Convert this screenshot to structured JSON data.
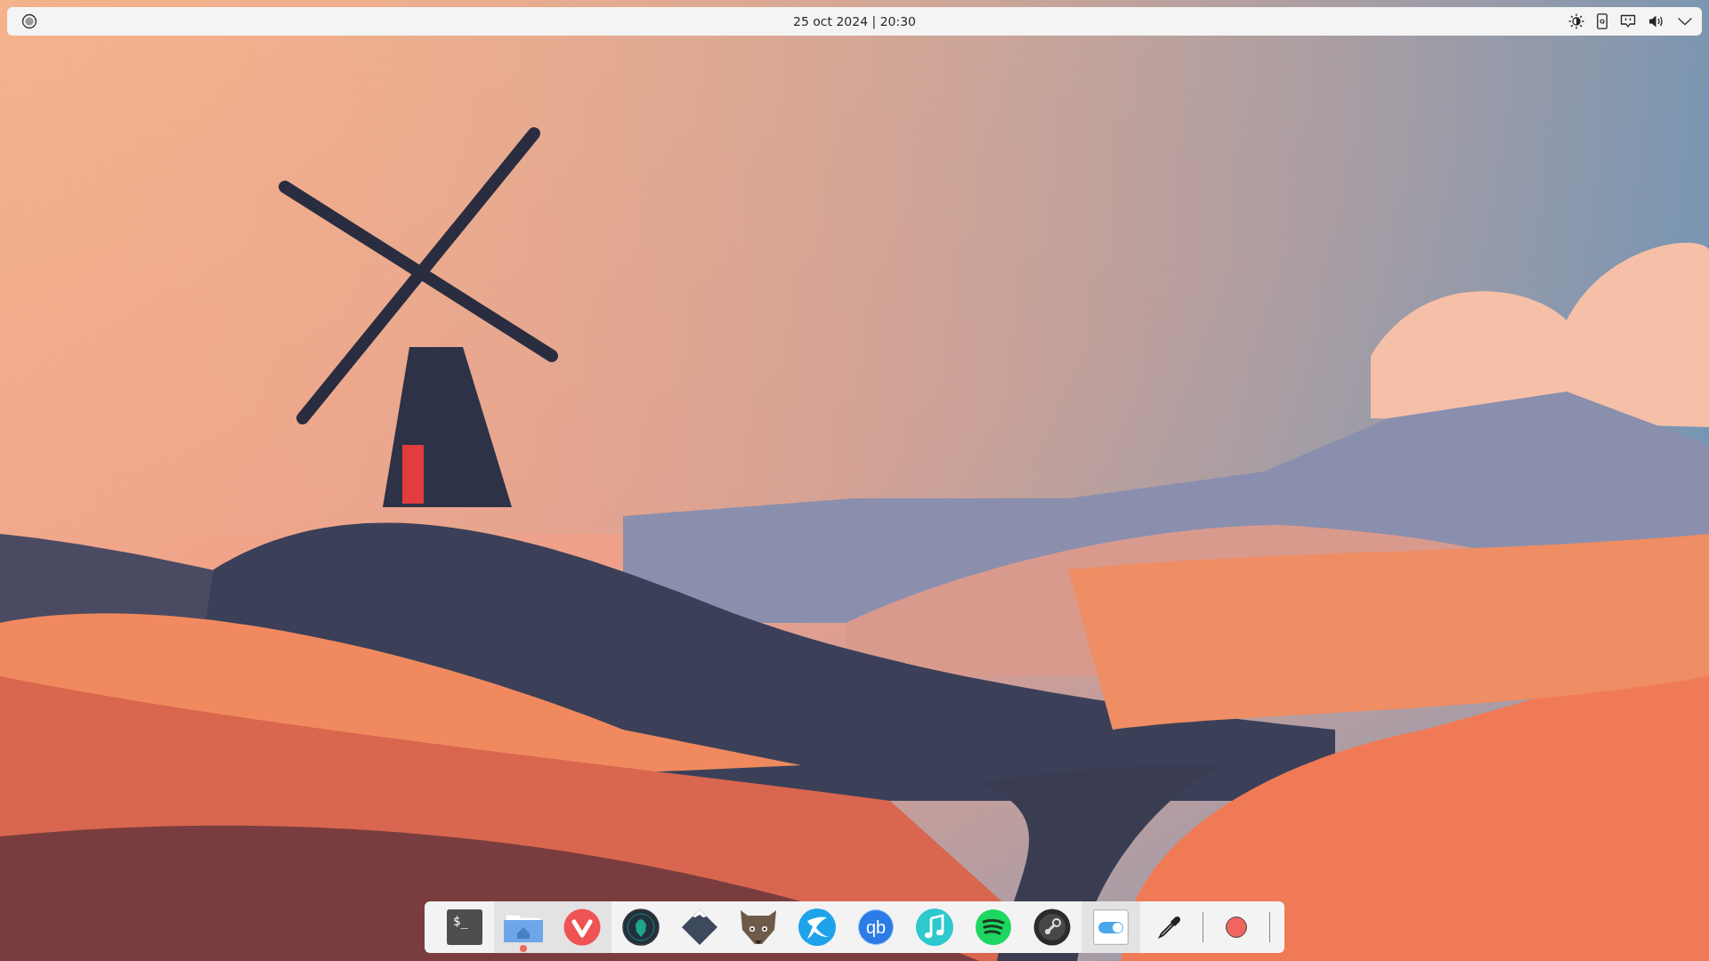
{
  "top_bar": {
    "clock": "25 oct 2024 | 20:30"
  },
  "dock": [
    {
      "kind": "terminal",
      "label": "$_",
      "selected": false,
      "running": false
    },
    {
      "kind": "files",
      "selected": true,
      "running": true
    },
    {
      "kind": "vivaldi",
      "selected": true,
      "running": false
    },
    {
      "kind": "gitkraken",
      "selected": false,
      "running": false
    },
    {
      "kind": "inkscape",
      "selected": false,
      "running": false
    },
    {
      "kind": "gnu",
      "selected": false,
      "running": false
    },
    {
      "kind": "kdenlive",
      "selected": false,
      "running": false
    },
    {
      "kind": "qbittorrent",
      "label": "qb",
      "selected": false,
      "running": false
    },
    {
      "kind": "music",
      "selected": false,
      "running": false
    },
    {
      "kind": "spotify",
      "selected": false,
      "running": false
    },
    {
      "kind": "steam",
      "selected": false,
      "running": false
    },
    {
      "kind": "toggle",
      "selected": true,
      "running": false
    },
    {
      "kind": "picker",
      "selected": false,
      "running": false
    },
    {
      "kind": "separator"
    },
    {
      "kind": "record",
      "selected": false,
      "running": false
    },
    {
      "kind": "separator"
    }
  ]
}
